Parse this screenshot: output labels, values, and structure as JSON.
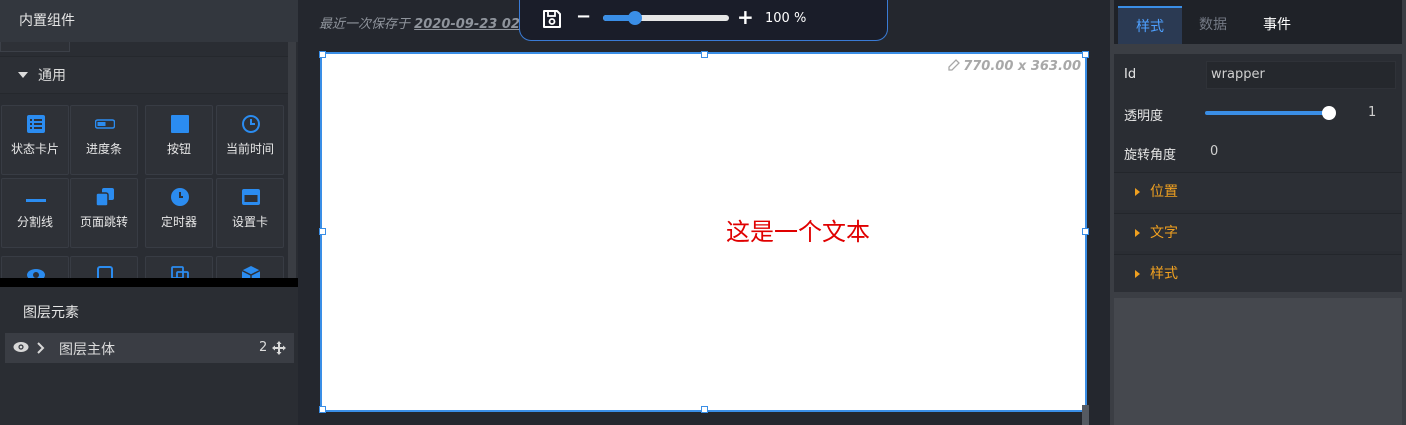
{
  "left_panel": {
    "title": "内置组件",
    "category": "通用",
    "components": [
      {
        "label": "状态卡片",
        "icon": "list-icon"
      },
      {
        "label": "进度条",
        "icon": "progress-icon"
      },
      {
        "label": "按钮",
        "icon": "square-icon"
      },
      {
        "label": "当前时间",
        "icon": "clock-icon"
      },
      {
        "label": "分割线",
        "icon": "divider-icon"
      },
      {
        "label": "页面跳转",
        "icon": "pages-icon"
      },
      {
        "label": "定时器",
        "icon": "timer-icon"
      },
      {
        "label": "设置卡",
        "icon": "card-icon"
      },
      {
        "label": "",
        "icon": "eye-icon"
      },
      {
        "label": "",
        "icon": "frame-icon"
      },
      {
        "label": "",
        "icon": "copy-icon"
      },
      {
        "label": "",
        "icon": "cube-icon"
      }
    ],
    "layers": {
      "title": "图层元素",
      "row": {
        "name": "图层主体",
        "count": "2"
      }
    }
  },
  "toolbar": {
    "saved_prefix": "最近一次保存于",
    "saved_time": "2020-09-23 02",
    "zoom_value": "100",
    "zoom_unit": "%",
    "zoom_level": 0.25
  },
  "canvas": {
    "dimensions": "770.00 x 363.00",
    "text": "这是一个文本",
    "text_color": "#e00000"
  },
  "right_panel": {
    "tabs": [
      "样式",
      "数据",
      "事件"
    ],
    "active_tab": "样式",
    "props": {
      "id_label": "Id",
      "id_value": "wrapper",
      "opacity_label": "透明度",
      "opacity_value": "1",
      "rotation_label": "旋转角度",
      "rotation_value": "0"
    },
    "sections": [
      "位置",
      "文字",
      "样式"
    ]
  },
  "colors": {
    "accent": "#3a8ee6",
    "section": "#f0a020"
  }
}
